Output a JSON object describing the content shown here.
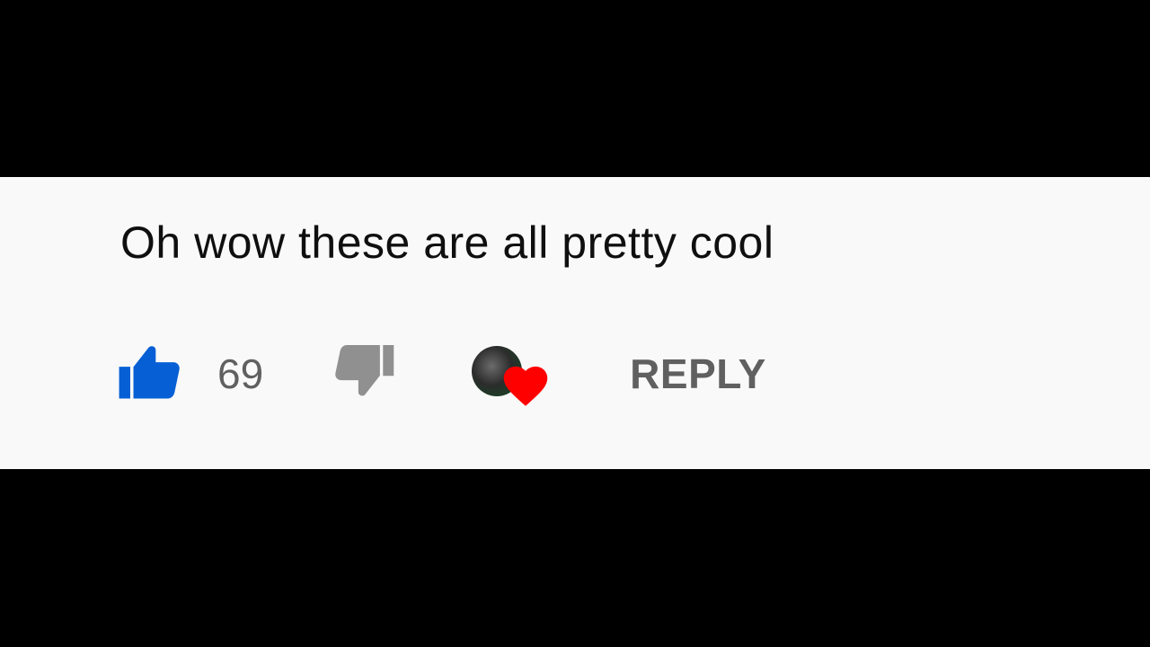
{
  "comment": {
    "text": "Oh wow these are all pretty cool",
    "like_count": "69",
    "reply_label": "REPLY"
  },
  "icons": {
    "like": "thumbs-up-icon",
    "dislike": "thumbs-down-icon",
    "creator_heart": "heart-icon"
  },
  "colors": {
    "like_active": "#065fd4",
    "dislike": "#909090",
    "heart": "#ff0000",
    "text_secondary": "#606060",
    "background": "#f9f9f9"
  }
}
